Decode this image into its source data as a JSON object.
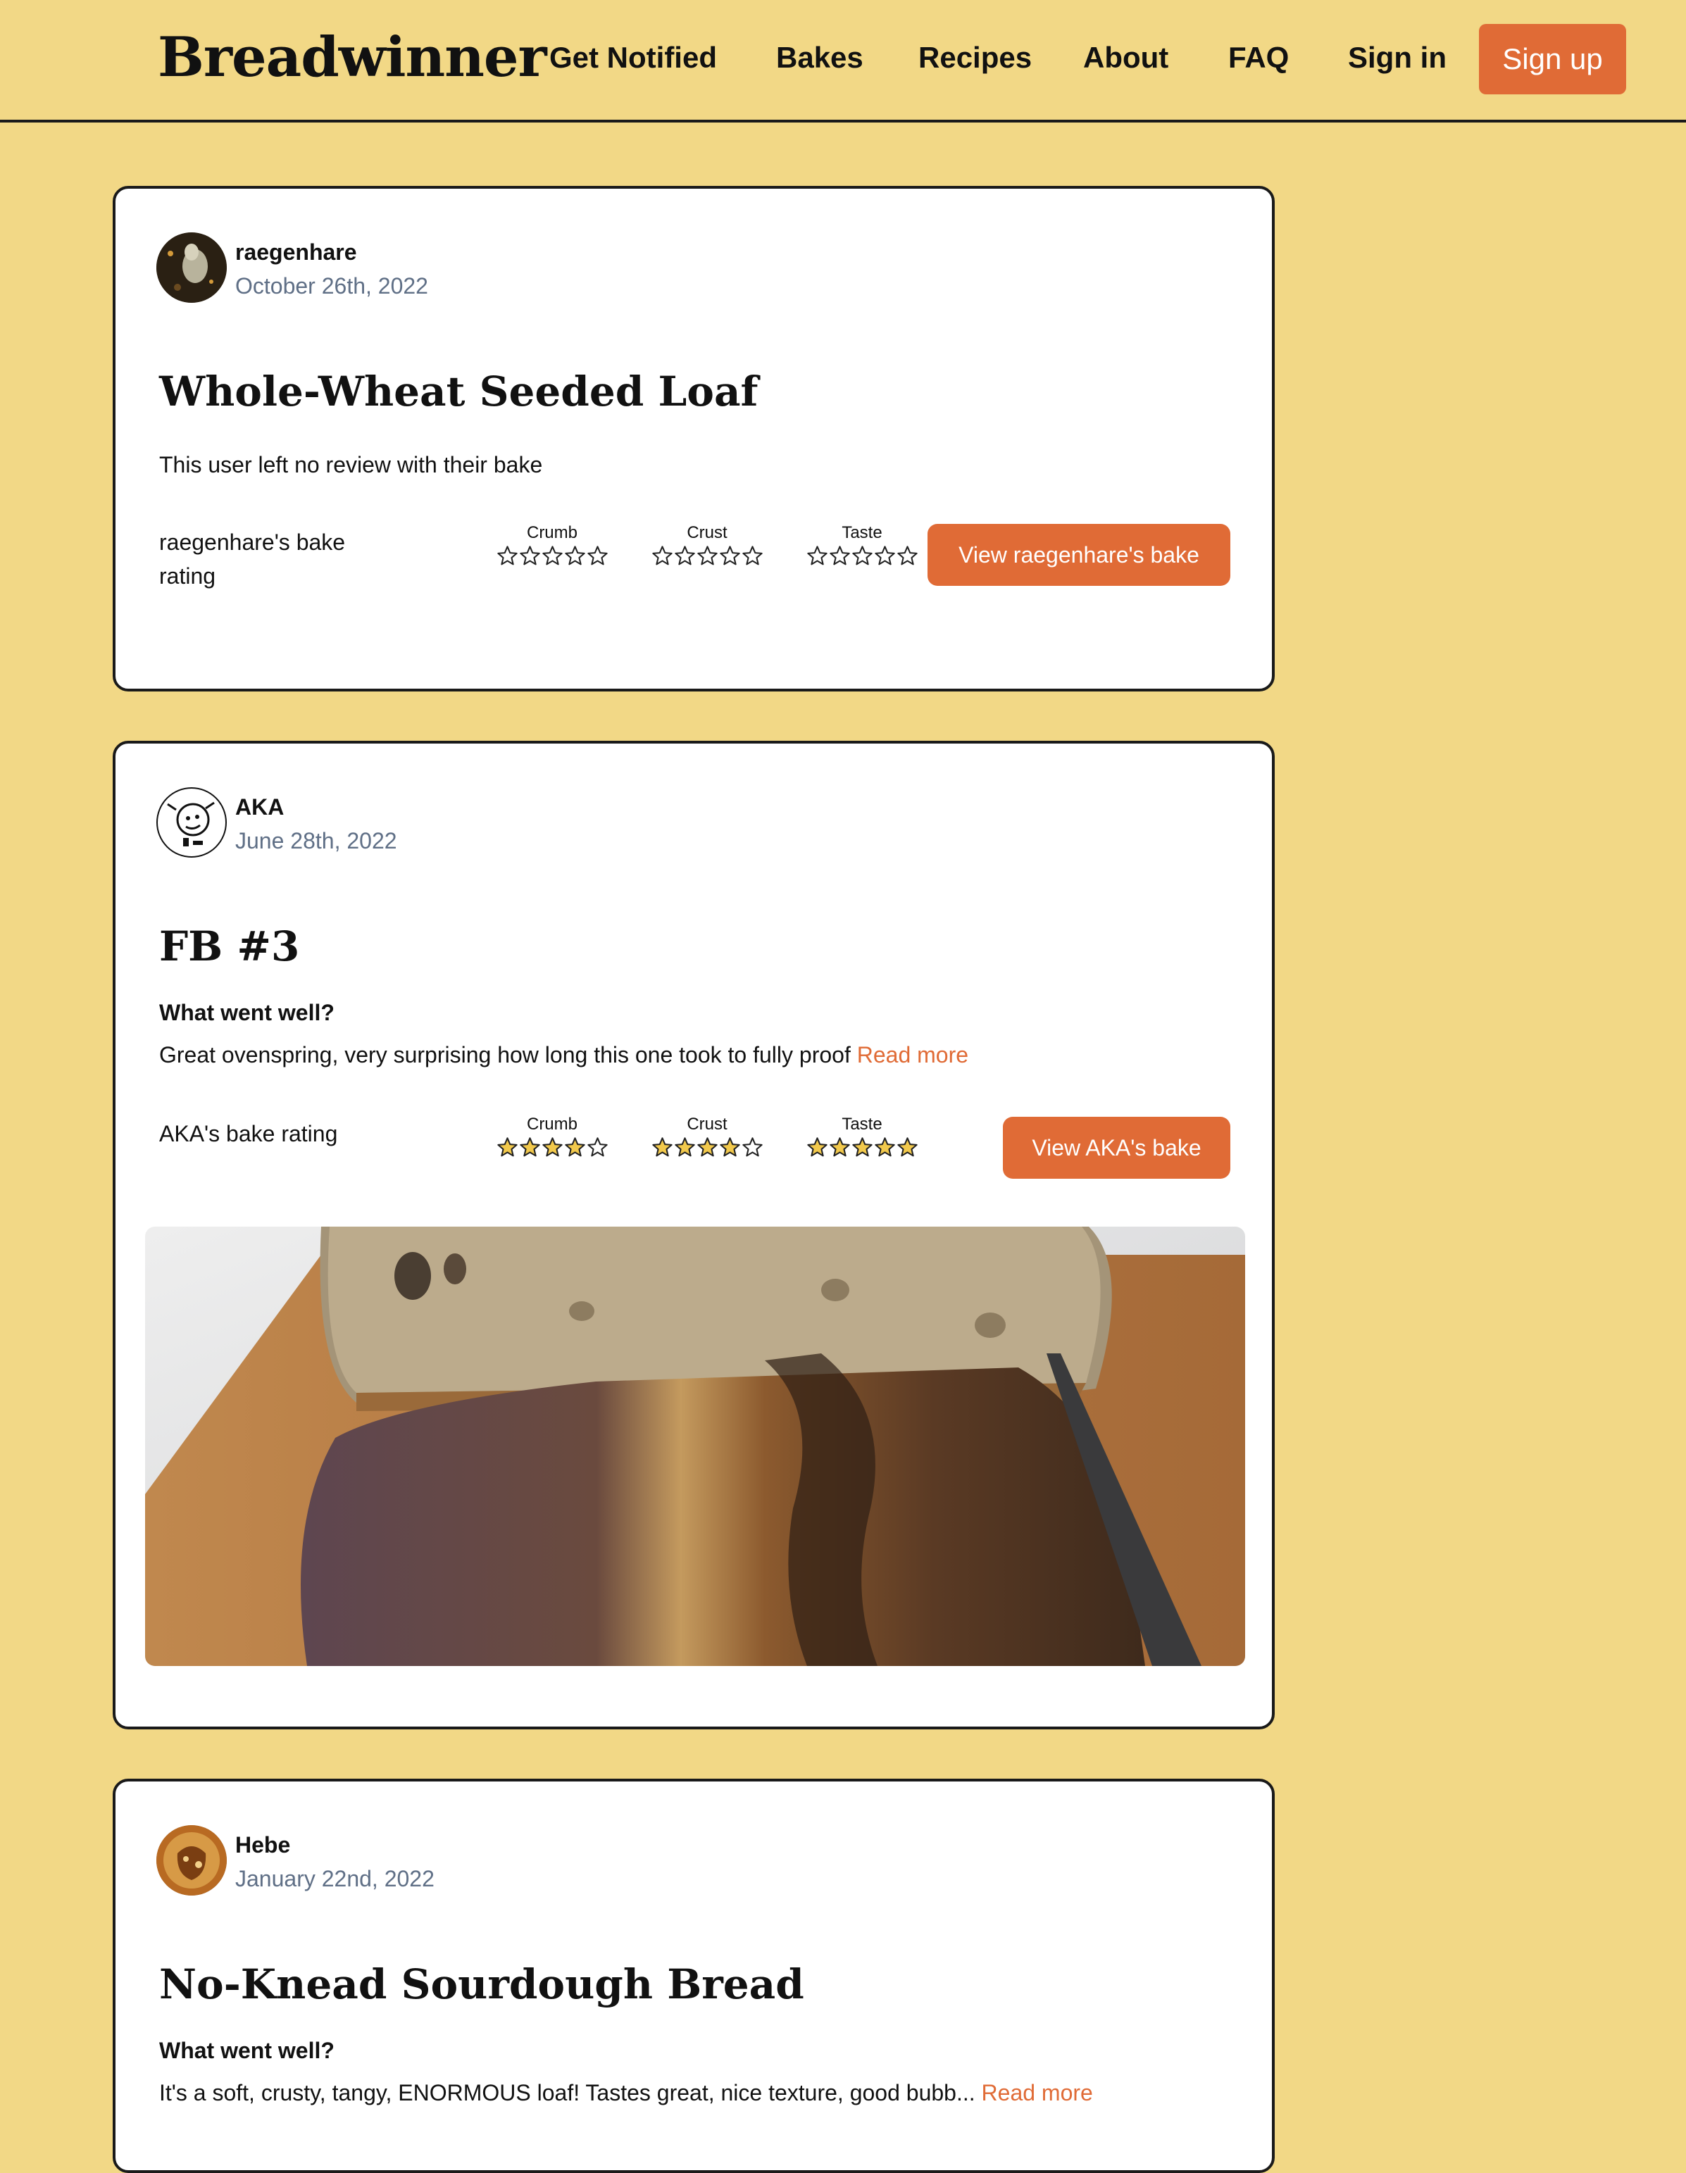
{
  "header": {
    "logo": "Breadwinner",
    "nav": [
      "Get Notified",
      "Bakes",
      "Recipes",
      "About",
      "FAQ",
      "Sign in"
    ],
    "signup_label": "Sign up"
  },
  "rating_categories": [
    "Crumb",
    "Crust",
    "Taste"
  ],
  "cards": [
    {
      "username": "raegenhare",
      "date": "October 26th, 2022",
      "title": "Whole-Wheat Seeded Loaf",
      "review_heading": "",
      "review_text": "This user left no review with their bake",
      "read_more": "",
      "rating_label": "raegenhare's bake rating",
      "ratings": {
        "crumb": 0,
        "crust": 0,
        "taste": 0
      },
      "button_label": "View raegenhare's bake"
    },
    {
      "username": "AKA",
      "date": "June 28th, 2022",
      "title": "FB #3",
      "review_heading": "What went well?",
      "review_text": "Great ovenspring, very surprising how long this one took to fully proof",
      "read_more": "Read more",
      "rating_label": "AKA's bake rating",
      "ratings": {
        "crumb": 4,
        "crust": 4,
        "taste": 5
      },
      "button_label": "View AKA's bake"
    },
    {
      "username": "Hebe",
      "date": "January 22nd, 2022",
      "title": "No-Knead Sourdough Bread",
      "review_heading": "What went well?",
      "review_text": "It's a soft, crusty, tangy, ENORMOUS loaf! Tastes great, nice texture, good bubb...",
      "read_more": "Read more"
    }
  ],
  "colors": {
    "background": "#f2d886",
    "accent": "#e06b36",
    "star_fill": "#f2c94c",
    "date_text": "#5f6f86"
  }
}
